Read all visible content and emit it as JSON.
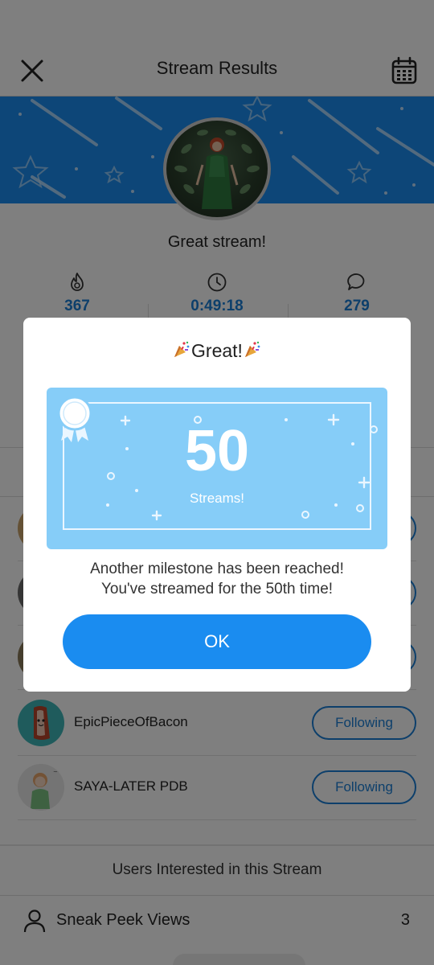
{
  "header": {
    "title": "Stream Results",
    "close_icon": "close-icon",
    "calendar_icon": "calendar-icon"
  },
  "banner": {
    "color": "#1a8cf0"
  },
  "greeting": "Great stream!",
  "stats": [
    {
      "icon": "flame-icon",
      "value": "367"
    },
    {
      "icon": "clock-icon",
      "value": "0:49:18"
    },
    {
      "icon": "comment-icon",
      "value": "279"
    }
  ],
  "followers": [
    {
      "name": "EpicPieceOfBacon",
      "button": "Following"
    },
    {
      "name": "SAYA-LATER PDB",
      "button": "Following"
    }
  ],
  "interested_label": "Users Interested in this Stream",
  "sneak_peek": {
    "label": "Sneak Peek Views",
    "count": "3",
    "icon": "person-icon"
  },
  "dialog": {
    "title": "Great!",
    "milestone_number": "50",
    "milestone_label": "Streams!",
    "message_line1": "Another milestone has been reached!",
    "message_line2": "You've streamed for the 50th time!",
    "ok_label": "OK",
    "accent_color": "#1a8cf0",
    "card_color": "#86cdf8"
  }
}
